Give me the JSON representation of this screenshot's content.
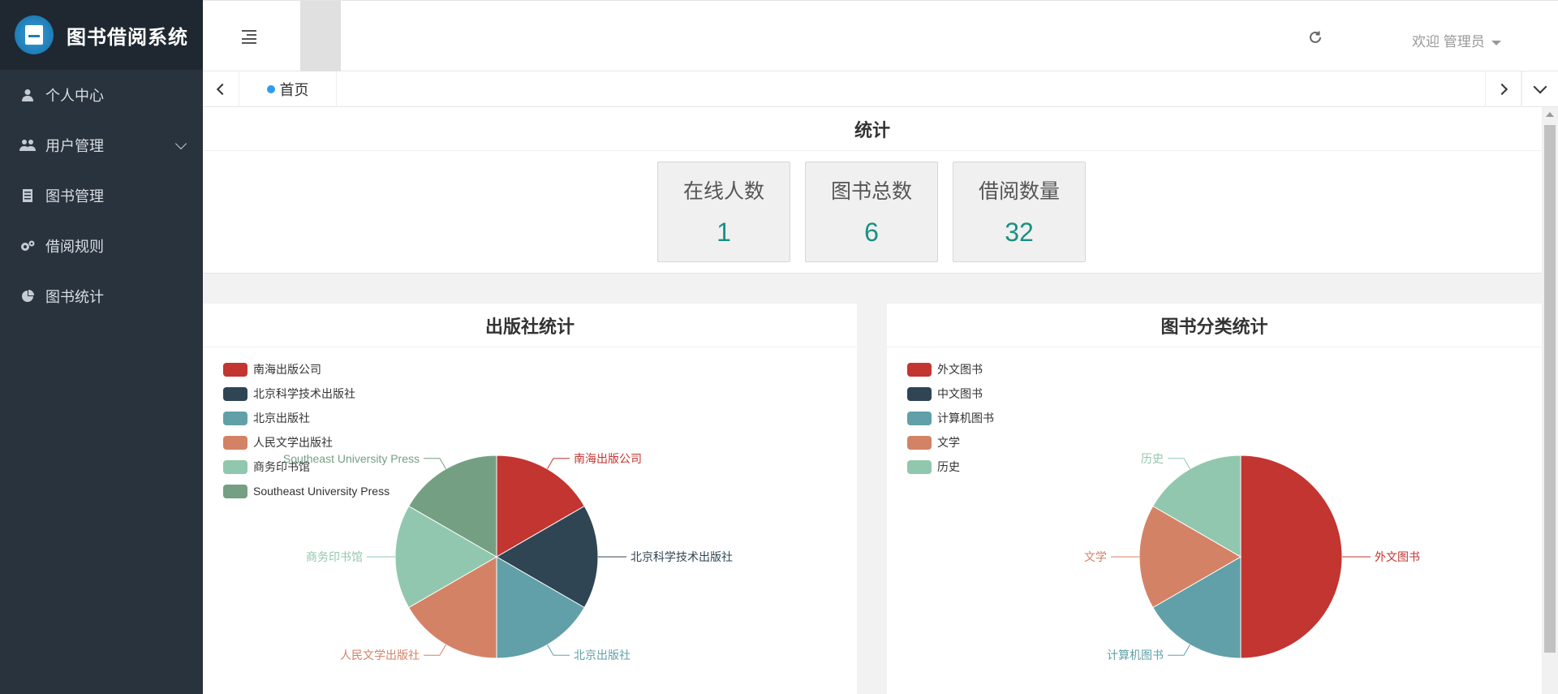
{
  "app": {
    "title": "图书借阅系统"
  },
  "sidebar": {
    "items": [
      {
        "label": "个人中心",
        "icon": "user-icon"
      },
      {
        "label": "用户管理",
        "icon": "users-icon",
        "expandable": true
      },
      {
        "label": "图书管理",
        "icon": "book-icon"
      },
      {
        "label": "借阅规则",
        "icon": "cogs-icon"
      },
      {
        "label": "图书统计",
        "icon": "pie-chart-icon"
      }
    ]
  },
  "header": {
    "welcome": "欢迎 管理员"
  },
  "tabs": [
    {
      "label": "首页",
      "active": true
    }
  ],
  "stats": {
    "title": "统计",
    "cards": [
      {
        "label": "在线人数",
        "value": "1"
      },
      {
        "label": "图书总数",
        "value": "6"
      },
      {
        "label": "借阅数量",
        "value": "32"
      }
    ]
  },
  "colors": {
    "accent_teal": "#1a9083",
    "sidebar_bg": "#28333e",
    "tab_dot": "#2d9cf0"
  },
  "chart_data": [
    {
      "type": "pie",
      "title": "出版社统计",
      "legend_position": "top-left",
      "slices": [
        {
          "name": "南海出版公司",
          "value": 1,
          "color": "#c23531"
        },
        {
          "name": "北京科学技术出版社",
          "value": 1,
          "color": "#2f4554"
        },
        {
          "name": "北京出版社",
          "value": 1,
          "color": "#61a0a8"
        },
        {
          "name": "人民文学出版社",
          "value": 1,
          "color": "#d48265"
        },
        {
          "name": "商务印书馆",
          "value": 1,
          "color": "#91c7ae"
        },
        {
          "name": "Southeast University Press",
          "value": 1,
          "color": "#749f83"
        }
      ]
    },
    {
      "type": "pie",
      "title": "图书分类统计",
      "legend_position": "top-left",
      "slices": [
        {
          "name": "外文图书",
          "value": 3,
          "color": "#c23531"
        },
        {
          "name": "中文图书",
          "value": 0,
          "color": "#2f4554"
        },
        {
          "name": "计算机图书",
          "value": 1,
          "color": "#61a0a8"
        },
        {
          "name": "文学",
          "value": 1,
          "color": "#d48265"
        },
        {
          "name": "历史",
          "value": 1,
          "color": "#91c7ae"
        }
      ]
    }
  ]
}
